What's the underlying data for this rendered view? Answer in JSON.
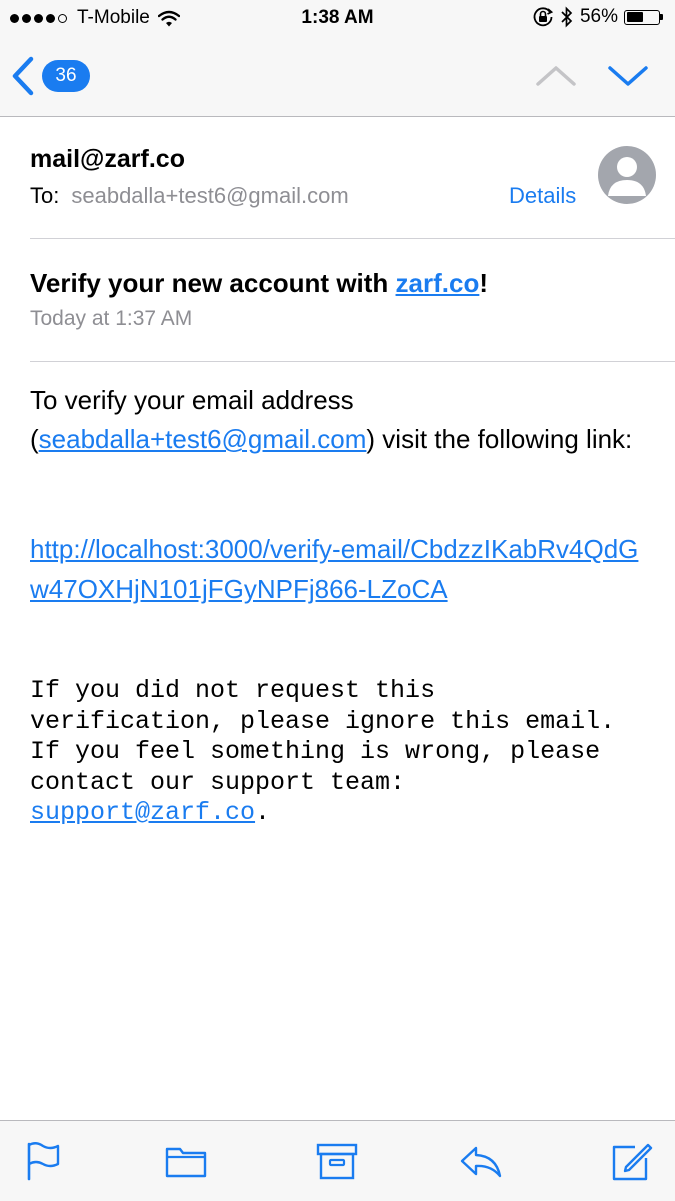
{
  "status_bar": {
    "carrier": "T-Mobile",
    "time": "1:38 AM",
    "battery_percent": "56%",
    "battery_level": 0.56,
    "signal_bars": 4,
    "icons": [
      "signal-dots-icon",
      "wifi-icon",
      "orientation-lock-icon",
      "bluetooth-icon",
      "battery-icon"
    ]
  },
  "nav": {
    "back_icon": "chevron-left-icon",
    "unread_count": "36",
    "prev_icon": "chevron-up-icon",
    "next_icon": "chevron-down-icon"
  },
  "message": {
    "from": "mail@zarf.co",
    "to_label": "To:",
    "to": "seabdalla+test6@gmail.com",
    "details_label": "Details",
    "subject_prefix": "Verify your new account with ",
    "subject_link": "zarf.co",
    "subject_suffix": "!",
    "date": "Today at 1:37 AM",
    "body": {
      "p1_text_1": "To verify your email address (",
      "p1_link": "seabdalla+test6@gmail.com",
      "p1_text_2": ") visit the following link:",
      "verify_link": "http://localhost:3000/verify-email/CbdzzIKabRv4QdGw47OXHjN101jFGyNPFj866-LZoCA",
      "p3_text": "If you did not request this verification, please ignore this email. If you feel something is wrong, please contact our support team: ",
      "p3_link": "support@zarf.co",
      "p3_end": "."
    }
  },
  "toolbar": {
    "items": [
      "flag-icon",
      "folder-icon",
      "archive-icon",
      "reply-icon",
      "compose-icon"
    ]
  },
  "colors": {
    "accent": "#1a7cf0",
    "secondary_text": "#8e8e93",
    "bar_background": "#f7f7f7"
  }
}
